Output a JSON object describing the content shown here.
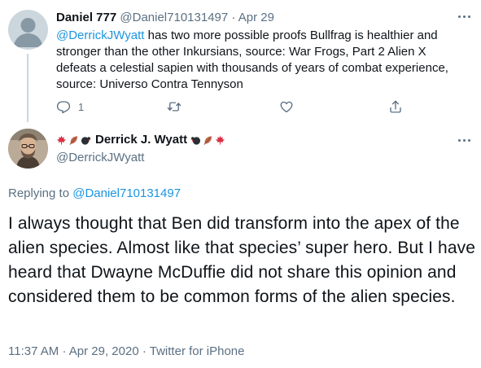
{
  "reply_tweet": {
    "display_name": "Daniel 777",
    "handle": "@Daniel710131497",
    "separator": "·",
    "date": "Apr 29",
    "mention": "@DerrickJWyatt",
    "text": " has two more possible proofs Bullfrag is healthier and stronger than the other Inkursians, source: War Frogs, Part 2 Alien X defeats a celestial sapien with thousands of years of combat experience, source: Universo Contra Tennyson",
    "reply_count": "1",
    "icons": [
      "reply-icon",
      "retweet-icon",
      "like-icon",
      "share-icon",
      "more-icon"
    ]
  },
  "main_tweet": {
    "display_name": "Derrick J. Wyatt",
    "name_emoji_left": [
      "maple-leaf-emoji",
      "fallen-leaf-emoji",
      "turkey-emoji"
    ],
    "name_emoji_right": [
      "turkey-emoji",
      "fallen-leaf-emoji",
      "maple-leaf-emoji"
    ],
    "handle": "@DerrickJWyatt",
    "replying_prefix": "Replying to ",
    "replying_to": "@Daniel710131497",
    "text": "I always thought that Ben did transform into the apex of the alien species. Almost like that species’ super hero. But I have heard that Dwayne McDuffie did not share this opinion and considered them to be common forms of the alien species.",
    "time": "11:37 AM",
    "separator": "·",
    "date": "Apr 29, 2020",
    "source": "Twitter for iPhone"
  },
  "colors": {
    "link": "#1b95e0",
    "muted": "#5b7083",
    "text": "#0f1419",
    "thread_line": "#ccd6dd"
  }
}
